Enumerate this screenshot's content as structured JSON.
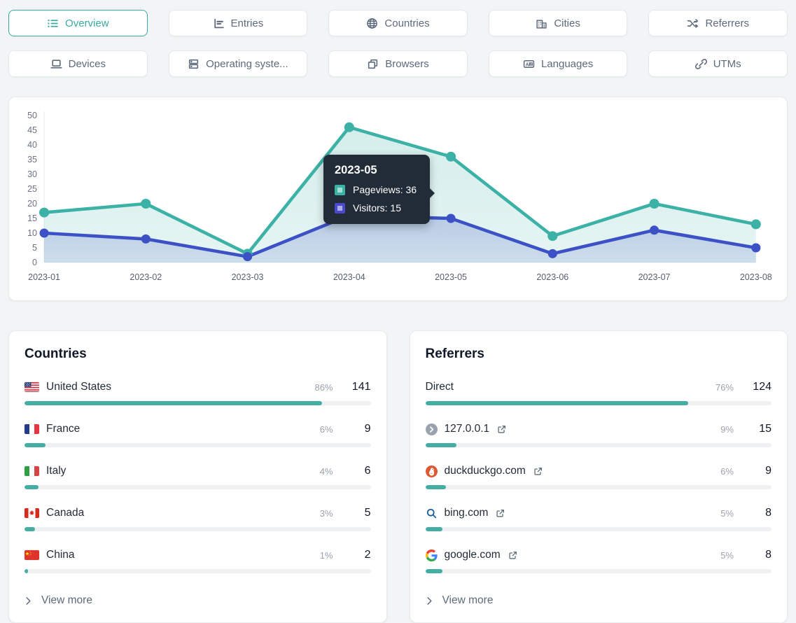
{
  "theme": {
    "accent_teal": "#3cb1a6",
    "accent_indigo": "#3d51c6",
    "bar_fill": "#44aea4",
    "tooltip_bg": "#222b38"
  },
  "tabs": [
    {
      "label": "Overview",
      "icon": "list-icon",
      "selected": true
    },
    {
      "label": "Entries",
      "icon": "bar-chart-icon",
      "selected": false
    },
    {
      "label": "Countries",
      "icon": "globe-icon",
      "selected": false
    },
    {
      "label": "Cities",
      "icon": "buildings-icon",
      "selected": false
    },
    {
      "label": "Referrers",
      "icon": "shuffle-icon",
      "selected": false
    },
    {
      "label": "Devices",
      "icon": "laptop-icon",
      "selected": false
    },
    {
      "label": "Operating syste...",
      "icon": "server-icon",
      "selected": false
    },
    {
      "label": "Browsers",
      "icon": "windows-icon",
      "selected": false
    },
    {
      "label": "Languages",
      "icon": "translate-icon",
      "selected": false
    },
    {
      "label": "UTMs",
      "icon": "link-icon",
      "selected": false
    }
  ],
  "chart_data": {
    "type": "line",
    "x": [
      "2023-01",
      "2023-02",
      "2023-03",
      "2023-04",
      "2023-05",
      "2023-06",
      "2023-07",
      "2023-08"
    ],
    "series": [
      {
        "name": "Pageviews",
        "color": "#3cb1a6",
        "values": [
          17,
          20,
          3,
          46,
          36,
          9,
          20,
          13
        ]
      },
      {
        "name": "Visitors",
        "color": "#3d51c6",
        "values": [
          10,
          8,
          2,
          16,
          15,
          3,
          11,
          5
        ]
      }
    ],
    "ylim": [
      0,
      50
    ],
    "yticks": [
      0,
      5,
      10,
      15,
      20,
      25,
      30,
      35,
      40,
      45,
      50
    ],
    "grid": false,
    "legend": "tooltip-only",
    "tooltip": {
      "title": "2023-05",
      "rows": [
        {
          "series": "Pageviews",
          "value": 36,
          "text": "Pageviews: 36"
        },
        {
          "series": "Visitors",
          "value": 15,
          "text": "Visitors: 15"
        }
      ]
    }
  },
  "countries": {
    "title": "Countries",
    "view_more": "View more",
    "rows": [
      {
        "label": "United States",
        "icon": "flag-united-states-icon",
        "pct": "86%",
        "pct_num": 86,
        "value": "141"
      },
      {
        "label": "France",
        "icon": "flag-france-icon",
        "pct": "6%",
        "pct_num": 6,
        "value": "9"
      },
      {
        "label": "Italy",
        "icon": "flag-italy-icon",
        "pct": "4%",
        "pct_num": 4,
        "value": "6"
      },
      {
        "label": "Canada",
        "icon": "flag-canada-icon",
        "pct": "3%",
        "pct_num": 3,
        "value": "5"
      },
      {
        "label": "China",
        "icon": "flag-china-icon",
        "pct": "1%",
        "pct_num": 1,
        "value": "2"
      }
    ]
  },
  "referrers": {
    "title": "Referrers",
    "view_more": "View more",
    "rows": [
      {
        "label": "Direct",
        "icon": null,
        "external_link": false,
        "pct": "76%",
        "pct_num": 76,
        "value": "124"
      },
      {
        "label": "127.0.0.1",
        "icon": "default-favicon-icon",
        "external_link": true,
        "pct": "9%",
        "pct_num": 9,
        "value": "15"
      },
      {
        "label": "duckduckgo.com",
        "icon": "duckduckgo-icon",
        "external_link": true,
        "pct": "6%",
        "pct_num": 6,
        "value": "9"
      },
      {
        "label": "bing.com",
        "icon": "bing-search-icon",
        "external_link": true,
        "pct": "5%",
        "pct_num": 5,
        "value": "8"
      },
      {
        "label": "google.com",
        "icon": "google-icon",
        "external_link": true,
        "pct": "5%",
        "pct_num": 5,
        "value": "8"
      }
    ]
  }
}
